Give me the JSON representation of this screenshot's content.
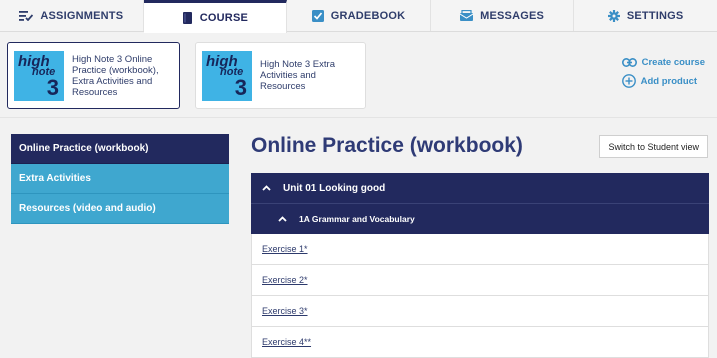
{
  "nav": {
    "tabs": [
      {
        "label": "ASSIGNMENTS",
        "icon": "assignments-icon"
      },
      {
        "label": "COURSE",
        "icon": "book-icon"
      },
      {
        "label": "GRADEBOOK",
        "icon": "gradebook-icon"
      },
      {
        "label": "MESSAGES",
        "icon": "messages-icon"
      },
      {
        "label": "SETTINGS",
        "icon": "gear-icon"
      }
    ],
    "active": "COURSE"
  },
  "products": [
    {
      "logo_text": [
        "high",
        "note",
        "3"
      ],
      "title": "High Note 3 Online Practice (workbook), Extra Activities and Resources",
      "selected": true
    },
    {
      "logo_text": [
        "high",
        "note",
        "3"
      ],
      "title": "High Note 3 Extra Activities and Resources",
      "selected": false
    }
  ],
  "course_actions": {
    "create": "Create course",
    "add": "Add product"
  },
  "sidebar": {
    "items": [
      {
        "label": "Online Practice (workbook)",
        "active": true
      },
      {
        "label": "Extra Activities",
        "active": false
      },
      {
        "label": "Resources (video and audio)",
        "active": false
      }
    ]
  },
  "main": {
    "title": "Online Practice (workbook)",
    "switch_label": "Switch to Student view",
    "unit": "Unit 01 Looking good",
    "lesson": "1A Grammar and Vocabulary",
    "exercises": [
      "Exercise 1*",
      "Exercise 2*",
      "Exercise 3*",
      "Exercise 4**"
    ]
  },
  "colors": {
    "navy": "#22295e",
    "sky": "#3fa7cf",
    "link": "#3a8fc6",
    "title": "#2f3b76"
  }
}
